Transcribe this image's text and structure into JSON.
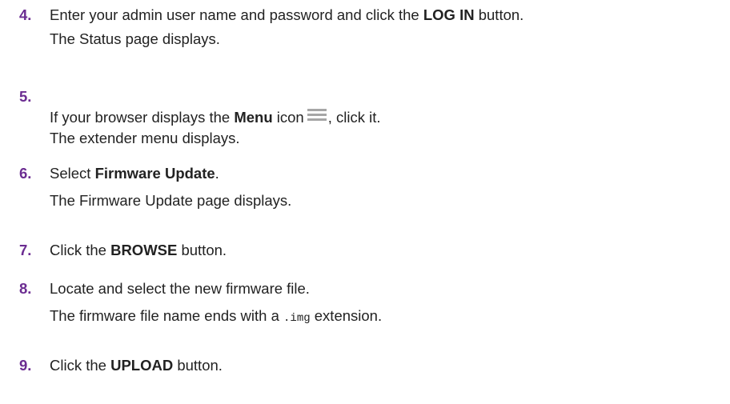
{
  "steps": [
    {
      "number": "4.",
      "line1": {
        "before": "Enter your admin user name and password and click the ",
        "bold": "LOG IN",
        "after": " button."
      },
      "line2": "The Status page displays."
    },
    {
      "number": "5.",
      "line1": {
        "before": "If your browser displays the ",
        "bold": "Menu",
        "mid": " icon",
        "after": ", click it."
      },
      "icon": "menu-hamburger-icon",
      "line2": "The extender menu displays."
    },
    {
      "number": "6.",
      "line1": {
        "before": "Select ",
        "bold": "Firmware Update",
        "after": "."
      },
      "line2": "The Firmware Update page displays."
    },
    {
      "number": "7.",
      "line1": {
        "before": "Click the ",
        "bold": "BROWSE",
        "after": " button."
      }
    },
    {
      "number": "8.",
      "line1": {
        "text": "Locate and select the new firmware file."
      },
      "line2": {
        "before": "The firmware file name ends with a ",
        "code": ".img",
        "after": " extension."
      }
    },
    {
      "number": "9.",
      "line1": {
        "before": "Click the ",
        "bold": "UPLOAD",
        "after": " button."
      }
    }
  ],
  "colors": {
    "number": "#6b2c91",
    "text": "#222222",
    "icon": "#a6a6a6"
  }
}
